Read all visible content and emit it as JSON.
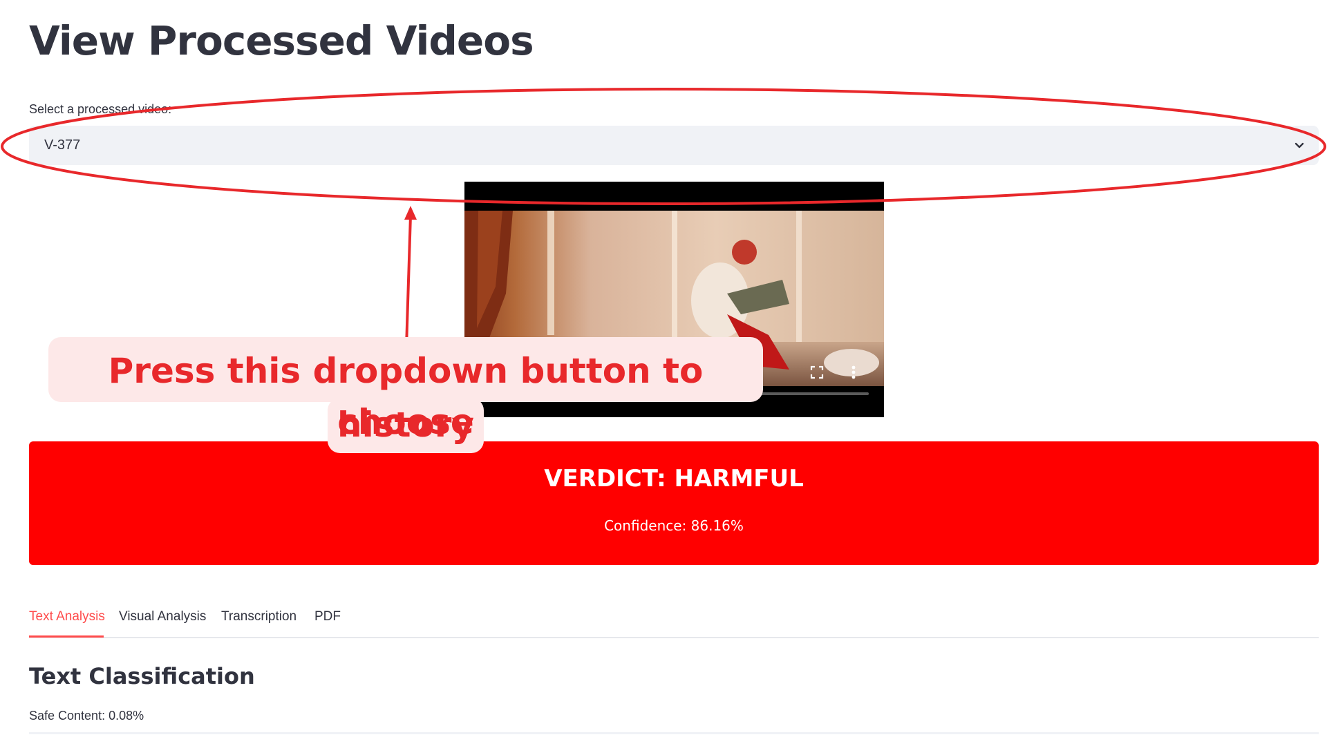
{
  "header": {
    "title": "View Processed Videos"
  },
  "selector": {
    "label": "Select a processed video:",
    "selected_value": "V-377"
  },
  "video": {
    "controls": [
      "fullscreen-icon",
      "more-options-icon"
    ]
  },
  "verdict": {
    "title": "VERDICT: HARMFUL",
    "confidence": "Confidence: 86.16%",
    "color": "#ff0000"
  },
  "tabs": [
    {
      "label": "Text Analysis",
      "active": true
    },
    {
      "label": "Visual Analysis",
      "active": false
    },
    {
      "label": "Transcription",
      "active": false
    },
    {
      "label": "PDF",
      "active": false
    }
  ],
  "text_classification": {
    "heading": "Text Classification",
    "safe_content": "Safe Content: 0.08%"
  },
  "annotation": {
    "line1": "Press this dropdown button to choose",
    "line2": "history",
    "color": "#e8282b"
  },
  "colors": {
    "accent": "#ff4b4b",
    "text": "#31333f",
    "select_bg": "#f0f2f6"
  }
}
